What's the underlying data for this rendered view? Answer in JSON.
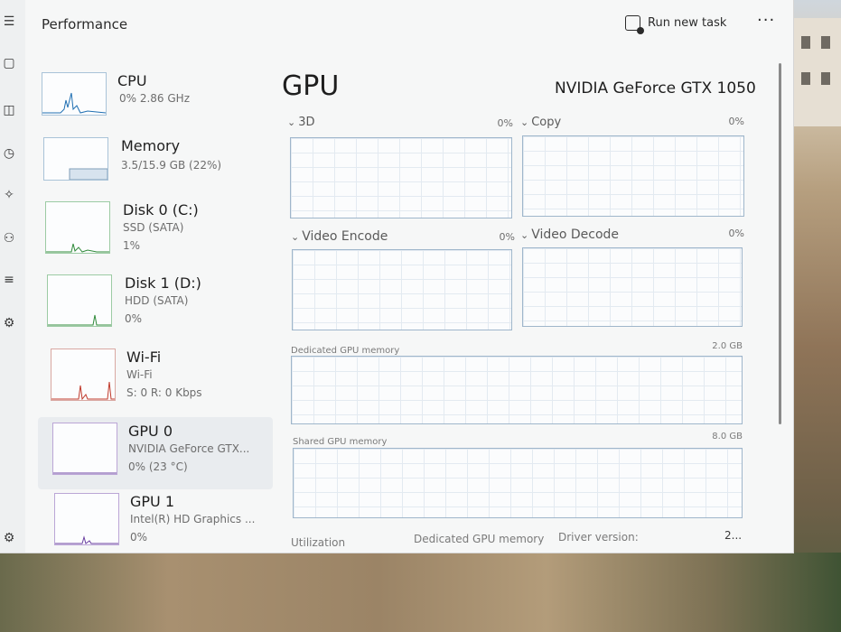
{
  "window": {
    "title": "Performance",
    "run_task_label": "Run new task",
    "more_label": "···"
  },
  "devices": [
    {
      "name": "CPU",
      "sub1": "0% 2.86 GHz"
    },
    {
      "name": "Memory",
      "sub1": "3.5/15.9 GB (22%)"
    },
    {
      "name": "Disk 0 (C:)",
      "sub1": "SSD (SATA)",
      "sub2": "1%"
    },
    {
      "name": "Disk 1 (D:)",
      "sub1": "HDD (SATA)",
      "sub2": "0%"
    },
    {
      "name": "Wi-Fi",
      "sub1": "Wi-Fi",
      "sub2": "S: 0 R: 0 Kbps"
    },
    {
      "name": "GPU 0",
      "sub1": "NVIDIA GeForce GTX...",
      "sub2": "0% (23 °C)"
    },
    {
      "name": "GPU 1",
      "sub1": "Intel(R) HD Graphics ...",
      "sub2": "0%"
    }
  ],
  "main": {
    "title": "GPU",
    "model": "NVIDIA GeForce GTX 1050",
    "engines": [
      {
        "label": "3D",
        "pct": "0%"
      },
      {
        "label": "Copy",
        "pct": "0%"
      },
      {
        "label": "Video Encode",
        "pct": "0%"
      },
      {
        "label": "Video Decode",
        "pct": "0%"
      }
    ],
    "dedicated_label": "Dedicated GPU memory",
    "dedicated_max": "2.0 GB",
    "shared_label": "Shared GPU memory",
    "shared_max": "8.0 GB",
    "bottom": {
      "utilization": "Utilization",
      "dedicated": "Dedicated GPU memory",
      "driver": "Driver version:",
      "driver_value": "2..."
    }
  },
  "colors": {
    "accent": "#1f6fb2",
    "disk": "#2f8a3a",
    "wifi": "#c0392b",
    "gpu": "#6a3fa0"
  }
}
